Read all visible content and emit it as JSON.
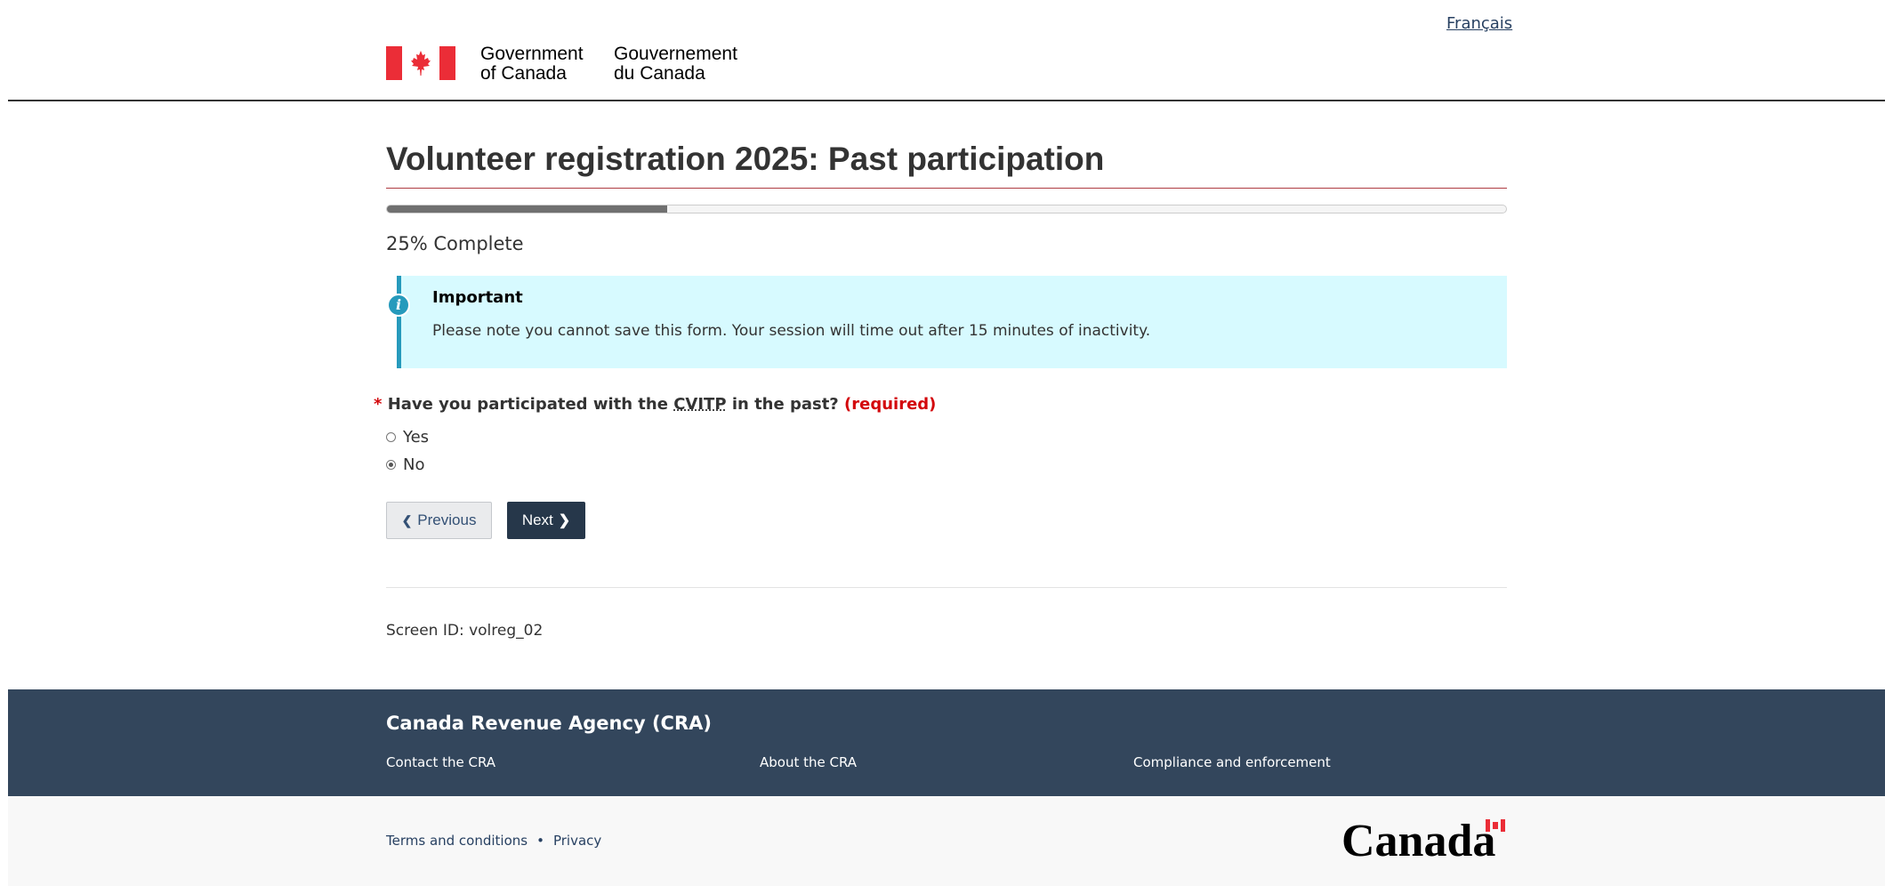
{
  "header": {
    "language_link": "Français",
    "signature_en_line1": "Government",
    "signature_en_line2": "of Canada",
    "signature_fr_line1": "Gouvernement",
    "signature_fr_line2": "du Canada"
  },
  "main": {
    "title": "Volunteer registration 2025: Past participation",
    "progress": {
      "percent": 25,
      "label": "25% Complete"
    },
    "alert": {
      "heading": "Important",
      "body": "Please note you cannot save this form. Your session will time out after 15 minutes of inactivity."
    },
    "question": {
      "required_mark": "*",
      "text_before": "Have you participated with the",
      "abbr": "CVITP",
      "text_after": "in the past?",
      "required_label": "(required)",
      "options": [
        {
          "label": "Yes",
          "checked": false
        },
        {
          "label": "No",
          "checked": true
        }
      ]
    },
    "buttons": {
      "previous": "Previous",
      "next": "Next"
    },
    "screen_id": "Screen ID: volreg_02"
  },
  "footer": {
    "title": "Canada Revenue Agency (CRA)",
    "links": [
      "Contact the CRA",
      "About the CRA",
      "Compliance and enforcement"
    ],
    "sub_links": [
      "Terms and conditions",
      "Privacy"
    ],
    "separator": "•",
    "wordmark": "Canada"
  },
  "colors": {
    "footer_bg": "#33465c",
    "button_primary": "#26374a",
    "alert_bg": "#d7faff",
    "alert_accent": "#269abc",
    "required_red": "#d3080c",
    "flag_red": "#eb2d37"
  },
  "icons": [
    "canada-flag-icon",
    "info-icon",
    "chevron-left-icon",
    "chevron-right-icon"
  ]
}
